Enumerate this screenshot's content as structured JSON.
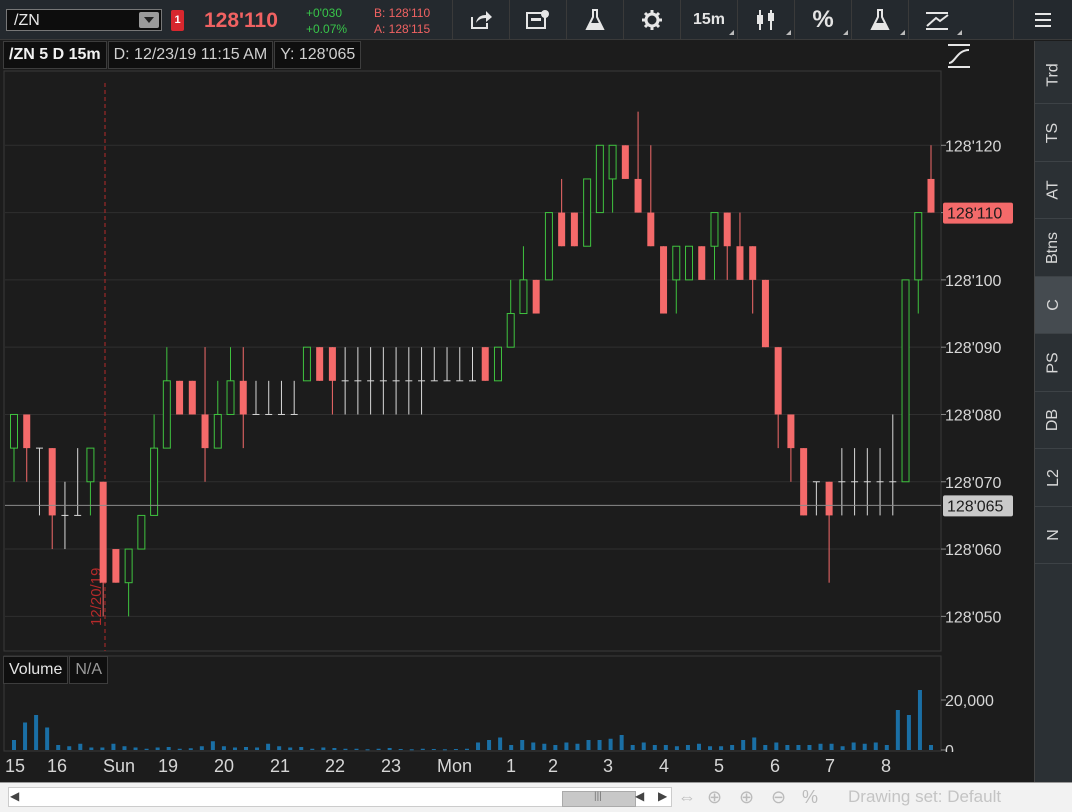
{
  "toolbar": {
    "symbol": "/ZN",
    "alert_count": "1",
    "last_price": "128'110",
    "net_change": "+0'030",
    "pct_change": "+0.07%",
    "bid": "B: 128'110",
    "ask": "A: 128'115",
    "timeframe": "15m",
    "percent_label": "%"
  },
  "chart_header": {
    "title": "/ZN 5 D 15m",
    "date": "D: 12/23/19 11:15 AM",
    "yvalue": "Y: 128'065"
  },
  "volume_header": {
    "label": "Volume",
    "value": "N/A"
  },
  "right_tabs": [
    "Trd",
    "TS",
    "AT",
    "Btns",
    "C",
    "PS",
    "DB",
    "L2",
    "N"
  ],
  "active_tab": "C",
  "bottom_bar": {
    "drawing_set": "Drawing set: Default"
  },
  "colors": {
    "up": "#3fc33f",
    "down": "#f46a6a",
    "flat": "#d8d8d8",
    "price_tag": "#f46a6a",
    "cursor_tag": "#c9c9c9",
    "volume_bar": "#1a6fa5",
    "session_line": "#b52a2a"
  },
  "chart_data": {
    "type": "candlestick",
    "price_unit": "128 and 32nds (x'yyy)",
    "y_ticks": [
      "128'050",
      "128'060",
      "128'070",
      "128'080",
      "128'090",
      "128'100",
      "128'110",
      "128'120"
    ],
    "current_price_tag": "128'110",
    "crosshair_tag": "128'065",
    "session_marker": "12/20/19",
    "x_labels": [
      "15",
      "16",
      "Sun",
      "19",
      "20",
      "21",
      "22",
      "23",
      "Mon",
      "1",
      "2",
      "3",
      "4",
      "5",
      "6",
      "7",
      "8"
    ],
    "volume_ticks": [
      "20,000",
      "0"
    ],
    "candles": [
      {
        "o": 128.075,
        "h": 128.08,
        "l": 128.07,
        "c": 128.08
      },
      {
        "o": 128.08,
        "h": 128.08,
        "l": 128.07,
        "c": 128.075
      },
      {
        "o": 128.075,
        "h": 128.075,
        "l": 128.065,
        "c": 128.075
      },
      {
        "o": 128.075,
        "h": 128.075,
        "l": 128.06,
        "c": 128.065
      },
      {
        "o": 128.065,
        "h": 128.07,
        "l": 128.06,
        "c": 128.065
      },
      {
        "o": 128.065,
        "h": 128.075,
        "l": 128.065,
        "c": 128.065
      },
      {
        "o": 128.07,
        "h": 128.075,
        "l": 128.065,
        "c": 128.075
      },
      {
        "o": 128.07,
        "h": 128.07,
        "l": 128.05,
        "c": 128.055
      },
      {
        "o": 128.06,
        "h": 128.06,
        "l": 128.055,
        "c": 128.055
      },
      {
        "o": 128.055,
        "h": 128.06,
        "l": 128.05,
        "c": 128.06
      },
      {
        "o": 128.06,
        "h": 128.065,
        "l": 128.06,
        "c": 128.065
      },
      {
        "o": 128.065,
        "h": 128.08,
        "l": 128.065,
        "c": 128.075
      },
      {
        "o": 128.075,
        "h": 128.09,
        "l": 128.075,
        "c": 128.085
      },
      {
        "o": 128.085,
        "h": 128.085,
        "l": 128.08,
        "c": 128.08
      },
      {
        "o": 128.085,
        "h": 128.085,
        "l": 128.08,
        "c": 128.08
      },
      {
        "o": 128.08,
        "h": 128.09,
        "l": 128.07,
        "c": 128.075
      },
      {
        "o": 128.075,
        "h": 128.085,
        "l": 128.075,
        "c": 128.08
      },
      {
        "o": 128.08,
        "h": 128.09,
        "l": 128.08,
        "c": 128.085
      },
      {
        "o": 128.085,
        "h": 128.09,
        "l": 128.075,
        "c": 128.08
      },
      {
        "o": 128.08,
        "h": 128.085,
        "l": 128.08,
        "c": 128.08
      },
      {
        "o": 128.08,
        "h": 128.085,
        "l": 128.08,
        "c": 128.08
      },
      {
        "o": 128.08,
        "h": 128.085,
        "l": 128.08,
        "c": 128.08
      },
      {
        "o": 128.08,
        "h": 128.085,
        "l": 128.08,
        "c": 128.08
      },
      {
        "o": 128.085,
        "h": 128.09,
        "l": 128.085,
        "c": 128.09
      },
      {
        "o": 128.09,
        "h": 128.09,
        "l": 128.085,
        "c": 128.085
      },
      {
        "o": 128.09,
        "h": 128.09,
        "l": 128.08,
        "c": 128.085
      },
      {
        "o": 128.085,
        "h": 128.09,
        "l": 128.08,
        "c": 128.085
      },
      {
        "o": 128.085,
        "h": 128.09,
        "l": 128.08,
        "c": 128.085
      },
      {
        "o": 128.085,
        "h": 128.09,
        "l": 128.08,
        "c": 128.085
      },
      {
        "o": 128.085,
        "h": 128.09,
        "l": 128.08,
        "c": 128.085
      },
      {
        "o": 128.085,
        "h": 128.09,
        "l": 128.08,
        "c": 128.085
      },
      {
        "o": 128.085,
        "h": 128.09,
        "l": 128.08,
        "c": 128.085
      },
      {
        "o": 128.085,
        "h": 128.09,
        "l": 128.08,
        "c": 128.085
      },
      {
        "o": 128.085,
        "h": 128.09,
        "l": 128.085,
        "c": 128.085
      },
      {
        "o": 128.085,
        "h": 128.09,
        "l": 128.085,
        "c": 128.085
      },
      {
        "o": 128.085,
        "h": 128.09,
        "l": 128.085,
        "c": 128.085
      },
      {
        "o": 128.085,
        "h": 128.09,
        "l": 128.085,
        "c": 128.085
      },
      {
        "o": 128.09,
        "h": 128.09,
        "l": 128.085,
        "c": 128.085
      },
      {
        "o": 128.085,
        "h": 128.09,
        "l": 128.085,
        "c": 128.09
      },
      {
        "o": 128.09,
        "h": 128.1,
        "l": 128.09,
        "c": 128.095
      },
      {
        "o": 128.095,
        "h": 128.105,
        "l": 128.095,
        "c": 128.1
      },
      {
        "o": 128.1,
        "h": 128.1,
        "l": 128.095,
        "c": 128.095
      },
      {
        "o": 128.1,
        "h": 128.11,
        "l": 128.1,
        "c": 128.11
      },
      {
        "o": 128.11,
        "h": 128.115,
        "l": 128.105,
        "c": 128.105
      },
      {
        "o": 128.11,
        "h": 128.11,
        "l": 128.105,
        "c": 128.105
      },
      {
        "o": 128.105,
        "h": 128.115,
        "l": 128.105,
        "c": 128.115
      },
      {
        "o": 128.11,
        "h": 128.12,
        "l": 128.11,
        "c": 128.12
      },
      {
        "o": 128.115,
        "h": 128.12,
        "l": 128.11,
        "c": 128.12
      },
      {
        "o": 128.12,
        "h": 128.12,
        "l": 128.115,
        "c": 128.115
      },
      {
        "o": 128.115,
        "h": 128.125,
        "l": 128.11,
        "c": 128.11
      },
      {
        "o": 128.11,
        "h": 128.12,
        "l": 128.105,
        "c": 128.105
      },
      {
        "o": 128.105,
        "h": 128.105,
        "l": 128.095,
        "c": 128.095
      },
      {
        "o": 128.1,
        "h": 128.105,
        "l": 128.095,
        "c": 128.105
      },
      {
        "o": 128.1,
        "h": 128.105,
        "l": 128.1,
        "c": 128.105
      },
      {
        "o": 128.105,
        "h": 128.105,
        "l": 128.1,
        "c": 128.1
      },
      {
        "o": 128.105,
        "h": 128.11,
        "l": 128.1,
        "c": 128.11
      },
      {
        "o": 128.11,
        "h": 128.11,
        "l": 128.1,
        "c": 128.105
      },
      {
        "o": 128.105,
        "h": 128.11,
        "l": 128.1,
        "c": 128.1
      },
      {
        "o": 128.105,
        "h": 128.105,
        "l": 128.095,
        "c": 128.1
      },
      {
        "o": 128.1,
        "h": 128.1,
        "l": 128.09,
        "c": 128.09
      },
      {
        "o": 128.09,
        "h": 128.09,
        "l": 128.075,
        "c": 128.08
      },
      {
        "o": 128.08,
        "h": 128.08,
        "l": 128.07,
        "c": 128.075
      },
      {
        "o": 128.075,
        "h": 128.075,
        "l": 128.065,
        "c": 128.065
      },
      {
        "o": 128.07,
        "h": 128.07,
        "l": 128.065,
        "c": 128.07
      },
      {
        "o": 128.07,
        "h": 128.07,
        "l": 128.055,
        "c": 128.065
      },
      {
        "o": 128.07,
        "h": 128.075,
        "l": 128.065,
        "c": 128.07
      },
      {
        "o": 128.07,
        "h": 128.075,
        "l": 128.065,
        "c": 128.07
      },
      {
        "o": 128.07,
        "h": 128.075,
        "l": 128.065,
        "c": 128.07
      },
      {
        "o": 128.07,
        "h": 128.075,
        "l": 128.065,
        "c": 128.07
      },
      {
        "o": 128.07,
        "h": 128.08,
        "l": 128.065,
        "c": 128.07
      },
      {
        "o": 128.07,
        "h": 128.1,
        "l": 128.07,
        "c": 128.1
      },
      {
        "o": 128.1,
        "h": 128.11,
        "l": 128.095,
        "c": 128.11
      },
      {
        "o": 128.115,
        "h": 128.12,
        "l": 128.11,
        "c": 128.11
      }
    ],
    "volume": [
      4000,
      11000,
      14000,
      9000,
      2000,
      1500,
      2500,
      1000,
      1000,
      2500,
      1500,
      1000,
      500,
      1000,
      1200,
      500,
      700,
      1500,
      3500,
      1500,
      1000,
      1200,
      1000,
      2500,
      1500,
      1000,
      1200,
      500,
      1000,
      800,
      500,
      500,
      300,
      500,
      800,
      400,
      300,
      500,
      400,
      300,
      400,
      500,
      3000,
      4000,
      5000,
      2000,
      4000,
      3000,
      2500,
      2000,
      3000,
      2500,
      4000,
      4000,
      4500,
      6000,
      2000,
      3000,
      2000,
      2000,
      1500,
      2000,
      2500,
      1500,
      1500,
      2000,
      4000,
      5000,
      2000,
      3000,
      2000,
      2000,
      2000,
      2500,
      2500,
      1500,
      3000,
      2500,
      3000,
      2000,
      16000,
      14000,
      24000,
      2000
    ]
  }
}
